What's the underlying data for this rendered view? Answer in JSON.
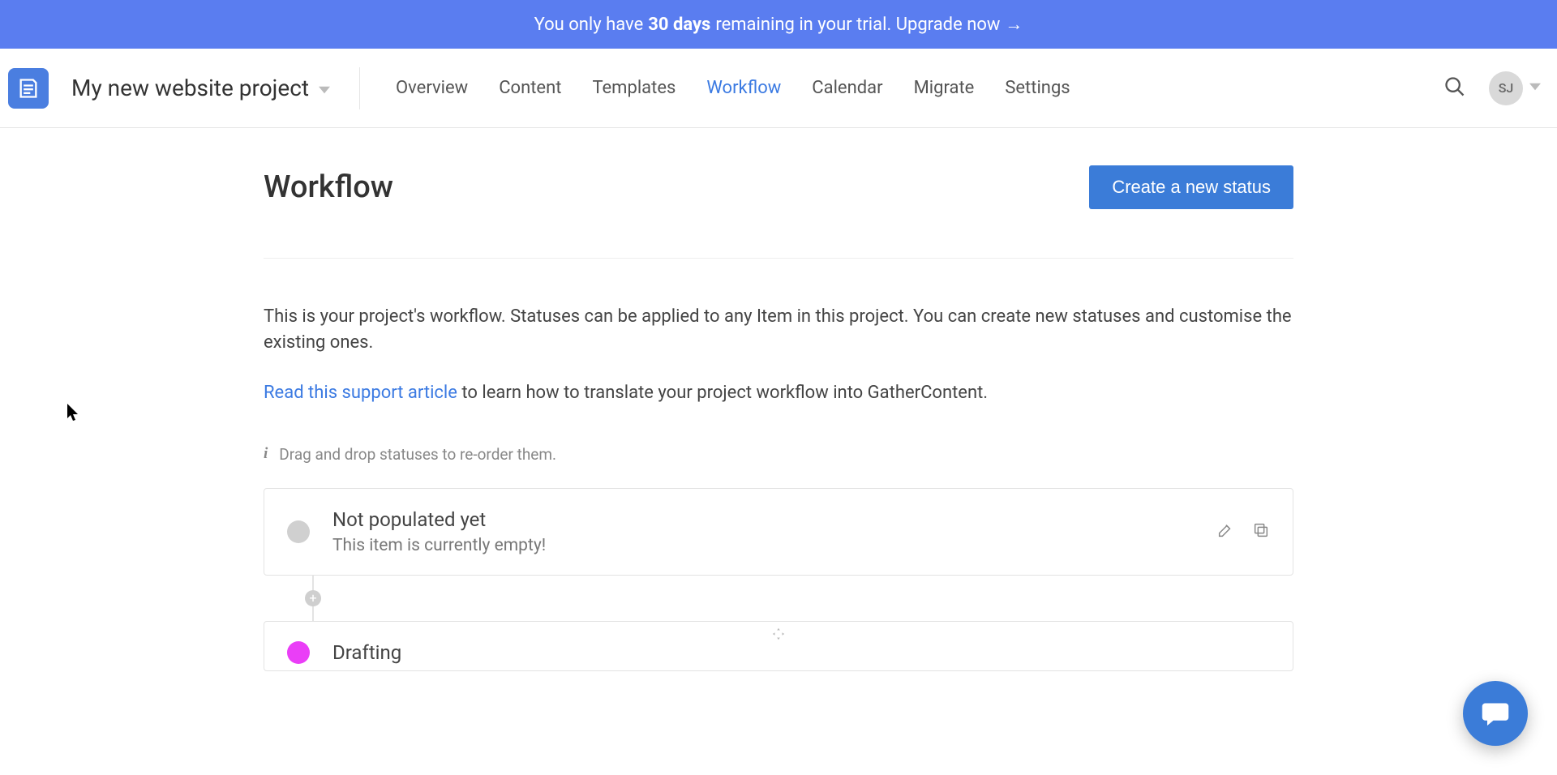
{
  "banner": {
    "prefix": "You only have",
    "days": "30 days",
    "suffix": "remaining in your trial. Upgrade now",
    "arrow": "→"
  },
  "project": {
    "name": "My new website project"
  },
  "nav": {
    "overview": "Overview",
    "content": "Content",
    "templates": "Templates",
    "workflow": "Workflow",
    "calendar": "Calendar",
    "migrate": "Migrate",
    "settings": "Settings"
  },
  "user": {
    "initials": "SJ"
  },
  "page": {
    "title": "Workflow",
    "create_button": "Create a new status",
    "intro1": "This is your project's workflow. Statuses can be applied to any Item in this project. You can create new statuses and customise the existing ones.",
    "intro2_link": "Read this support article",
    "intro2_rest": " to learn how to translate your project workflow into GatherContent.",
    "hint": "Drag and drop statuses to re-order them."
  },
  "statuses": [
    {
      "name": "Not populated yet",
      "desc": "This item is currently empty!",
      "color": "grey"
    },
    {
      "name": "Drafting",
      "desc": "",
      "color": "pink"
    }
  ]
}
